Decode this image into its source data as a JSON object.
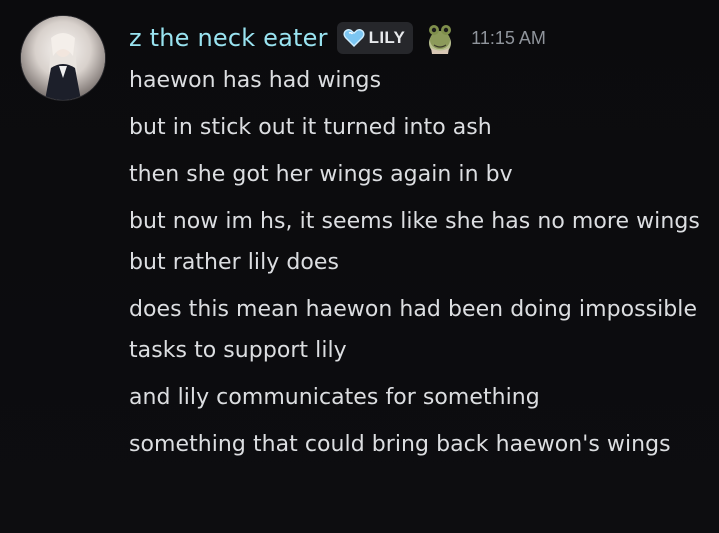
{
  "message": {
    "author": {
      "username": "z the neck eater",
      "tag_label": "LILY",
      "tag_icon": "heart-icon",
      "role_icon": "frog-icon",
      "avatar_icon": "avatar-image"
    },
    "timestamp": "11:15 AM",
    "lines": [
      "haewon has had wings",
      "but in stick out it turned into ash",
      "then she got her wings again in bv",
      "but now im hs, it seems like she has no more wings but rather lily does",
      "does this mean haewon had been doing impossible tasks to support lily",
      "and lily communicates for something",
      "something that could bring back haewon's wings"
    ]
  },
  "colors": {
    "username": "#99e3f0",
    "text": "#dcdee1",
    "timestamp": "#8f949b",
    "tag_bg": "#26272b",
    "background": "#0c0c0e"
  }
}
